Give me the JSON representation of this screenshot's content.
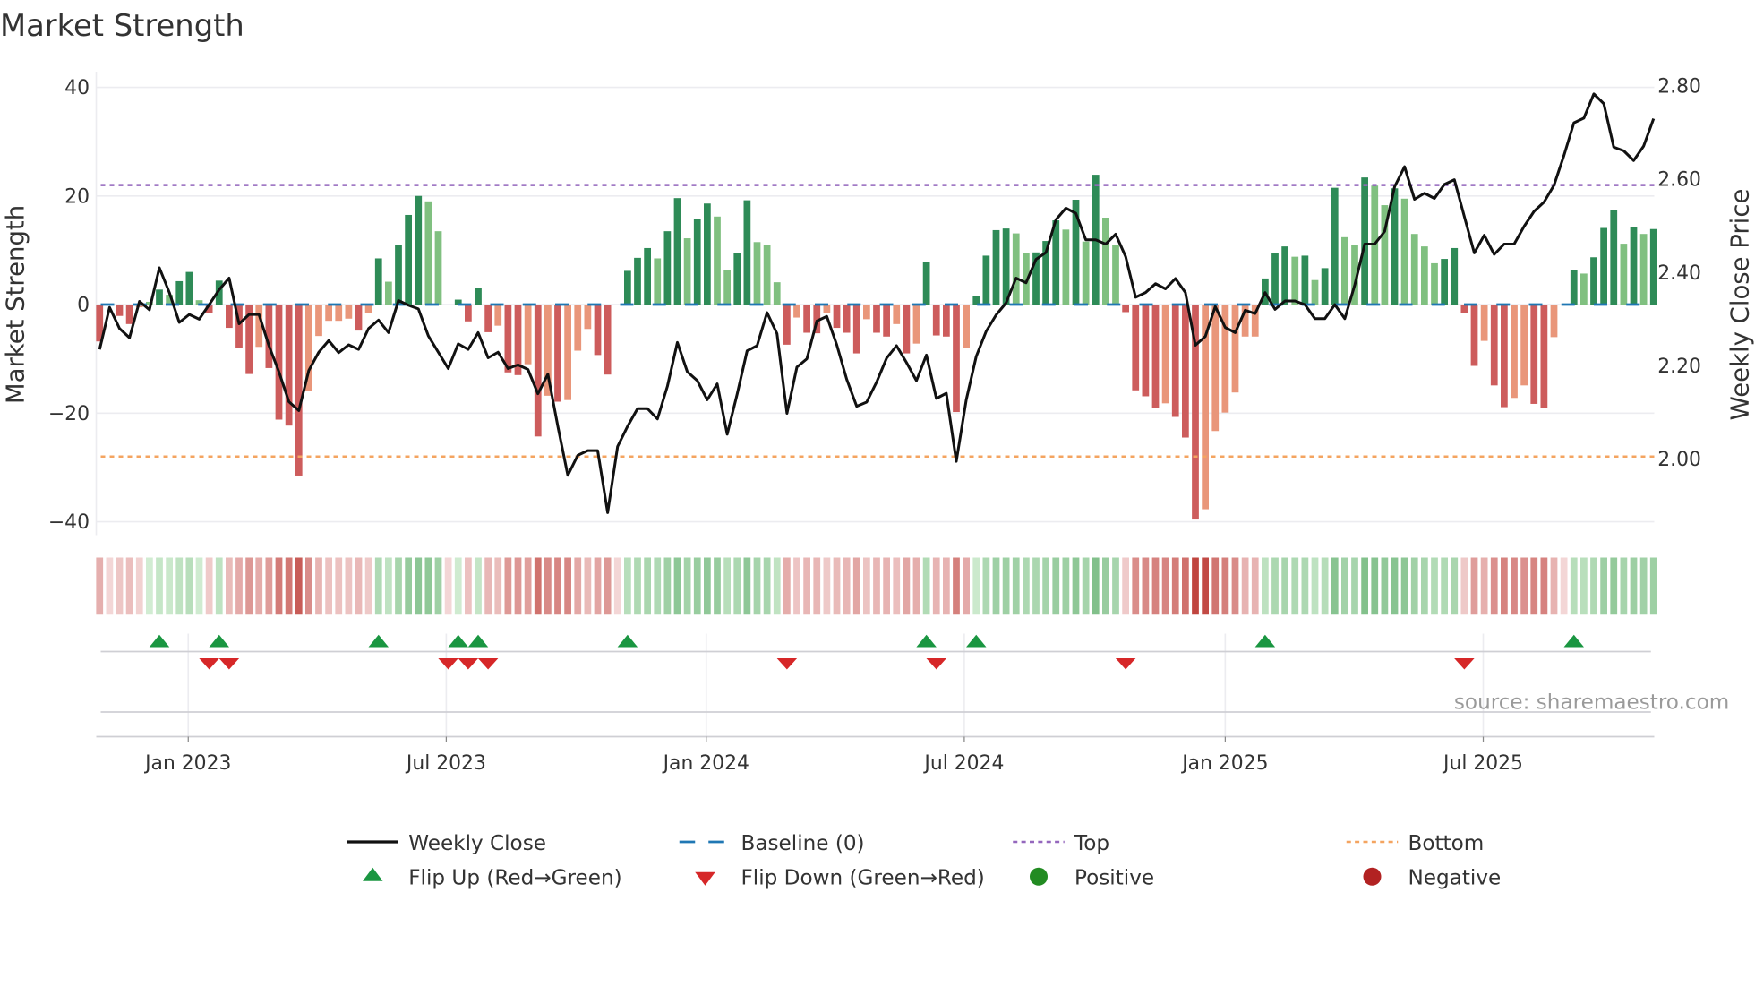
{
  "chart_data": {
    "type": "bar",
    "title": "Market Strength",
    "source": "source: sharemaestro.com",
    "ylabel": "Market Strength",
    "y2label": "Weekly Close Price",
    "ylim": [
      -42,
      42
    ],
    "y2lim": [
      1.87,
      2.81
    ],
    "top_level": 22,
    "bottom_level": -28,
    "grid": true,
    "y_left": {
      "ticks": [
        {
          "value": 40,
          "label": "40"
        },
        {
          "value": 20,
          "label": "20"
        },
        {
          "value": 0,
          "label": "0"
        },
        {
          "value": -20,
          "label": "−20"
        },
        {
          "value": -40,
          "label": "−40"
        }
      ]
    },
    "y_right": {
      "ticks": [
        {
          "value": 2.8,
          "label": "2.80"
        },
        {
          "value": 2.6,
          "label": "2.60"
        },
        {
          "value": 2.4,
          "label": "2.40"
        },
        {
          "value": 2.2,
          "label": "2.20"
        },
        {
          "value": 2.0,
          "label": "2.00"
        }
      ]
    },
    "x_ticks": [
      {
        "week": 8.9,
        "label": "Jan 2023"
      },
      {
        "week": 34.8,
        "label": "Jul 2023"
      },
      {
        "week": 60.9,
        "label": "Jan 2024"
      },
      {
        "week": 86.8,
        "label": "Jul 2024"
      },
      {
        "week": 113,
        "label": "Jan 2025"
      },
      {
        "week": 138.9,
        "label": "Jul 2025"
      }
    ],
    "strength": [
      -6.8,
      0,
      -2.1,
      -3.6,
      -0.5,
      0.5,
      2.75,
      1.8,
      4.3,
      6.0,
      0.8,
      -1.5,
      4.4,
      -4.3,
      -8,
      -12.8,
      -7.8,
      -11.7,
      -21.2,
      -22.3,
      -31.5,
      -16,
      -5.8,
      -3,
      -3,
      -2.6,
      -4.8,
      -1.6,
      8.5,
      4.2,
      11,
      16.5,
      20,
      19,
      13.5,
      0,
      0.9,
      -3.1,
      3.1,
      -5.1,
      -3.9,
      -12.5,
      -13,
      -11,
      -24.3,
      -16.8,
      -17.9,
      -17.6,
      -8.5,
      -4.5,
      -9.3,
      -12.9,
      0,
      6.2,
      8.6,
      10.4,
      8.5,
      13.5,
      19.6,
      12.2,
      15.8,
      18.6,
      16.2,
      6.3,
      9.5,
      19.2,
      11.5,
      10.9,
      4.1,
      -7.4,
      -2.4,
      -5.2,
      -5.3,
      -1.6,
      -4.3,
      -5.2,
      -9,
      -2.7,
      -5.2,
      -5.9,
      -3.6,
      -9,
      -7.2,
      7.9,
      -5.7,
      -5.9,
      -19.8,
      -8,
      1.6,
      9,
      13.7,
      14,
      13.1,
      9.5,
      9.6,
      11.7,
      15.5,
      13.8,
      19.3,
      11.6,
      23.9,
      16,
      10.9,
      -1.4,
      -15.8,
      -16.9,
      -19,
      -18.2,
      -20.7,
      -24.5,
      -39.6,
      -37.7,
      -23.3,
      -19.9,
      -16.2,
      -5.9,
      -5.9,
      4.8,
      9.4,
      10.7,
      8.8,
      9,
      4.5,
      6.7,
      21.5,
      12.4,
      10.9,
      23.4,
      21.9,
      18.3,
      21.4,
      19.5,
      13,
      10.7,
      7.6,
      8.4,
      10.4,
      -1.6,
      -11.3,
      -6.7,
      -14.9,
      -18.9,
      -17.2,
      -14.9,
      -18.3,
      -19,
      -6,
      0,
      6.3,
      5.7,
      8.7,
      14.1,
      17.4,
      11.2,
      14.3,
      13,
      13.9
    ],
    "shade": "R-RRrgGgGGgRGRRRrRRRRrrrrrRrGgGGGgg-GRGRrRRrRrRrrrRR-GGGgGGgGGggGGgggRrRRrRRRrRRrRrGRRRrGGGGggGGGgGgGggRRRRrRRRrrrrrrGGGgGgGGggGggGggggGGRRrRRrrRRr-GgGGGgGgG",
    "weekly_close": [
      2.235,
      2.325,
      2.28,
      2.26,
      2.338,
      2.32,
      2.41,
      2.357,
      2.293,
      2.31,
      2.3,
      2.331,
      2.363,
      2.388,
      2.29,
      2.31,
      2.31,
      2.243,
      2.187,
      2.123,
      2.104,
      2.19,
      2.229,
      2.254,
      2.228,
      2.245,
      2.235,
      2.28,
      2.298,
      2.271,
      2.34,
      2.33,
      2.322,
      2.264,
      2.229,
      2.194,
      2.247,
      2.235,
      2.271,
      2.217,
      2.229,
      2.194,
      2.202,
      2.192,
      2.14,
      2.182,
      2.07,
      1.965,
      2.008,
      2.018,
      2.018,
      1.885,
      2.027,
      2.07,
      2.108,
      2.108,
      2.086,
      2.156,
      2.25,
      2.187,
      2.168,
      2.127,
      2.161,
      2.053,
      2.139,
      2.232,
      2.243,
      2.314,
      2.269,
      2.098,
      2.197,
      2.215,
      2.296,
      2.306,
      2.245,
      2.171,
      2.113,
      2.122,
      2.165,
      2.216,
      2.243,
      2.207,
      2.168,
      2.223,
      2.13,
      2.141,
      1.995,
      2.127,
      2.22,
      2.274,
      2.309,
      2.335,
      2.388,
      2.378,
      2.428,
      2.443,
      2.513,
      2.538,
      2.527,
      2.47,
      2.47,
      2.461,
      2.482,
      2.434,
      2.347,
      2.357,
      2.376,
      2.365,
      2.387,
      2.357,
      2.244,
      2.263,
      2.327,
      2.282,
      2.271,
      2.319,
      2.312,
      2.357,
      2.321,
      2.339,
      2.339,
      2.331,
      2.301,
      2.301,
      2.331,
      2.301,
      2.373,
      2.461,
      2.461,
      2.488,
      2.584,
      2.627,
      2.557,
      2.57,
      2.559,
      2.589,
      2.599,
      2.52,
      2.442,
      2.48,
      2.439,
      2.461,
      2.461,
      2.499,
      2.531,
      2.551,
      2.587,
      2.651,
      2.721,
      2.731,
      2.783,
      2.762,
      2.669,
      2.661,
      2.64,
      2.671,
      2.73
    ],
    "flip_up_weeks": [
      6,
      12,
      28,
      36,
      38,
      53,
      83,
      88,
      117,
      148
    ],
    "flip_down_weeks": [
      11,
      13,
      35,
      37,
      39,
      69,
      84,
      103,
      137
    ],
    "colors": {
      "bar_dark_green": "#2e8b57",
      "bar_light_green": "#80c080",
      "bar_dark_red": "#cd5c5c",
      "bar_light_red": "#e9967a",
      "baseline": "#1f77b4",
      "top": "#9467bd",
      "bottom": "#f4a460",
      "flip_up": "#1a9641",
      "flip_down": "#d62728",
      "positive": "#228b22",
      "negative": "#b22222",
      "close": "#111111"
    },
    "legend": {
      "placement": "bottom",
      "items": [
        {
          "label": "Weekly Close",
          "kind": "line"
        },
        {
          "label": "Baseline (0)",
          "kind": "dash"
        },
        {
          "label": "Top",
          "kind": "dot-purple"
        },
        {
          "label": "Bottom",
          "kind": "dot-orange"
        },
        {
          "label": "Flip Up (Red→Green)",
          "kind": "tri-up"
        },
        {
          "label": "Flip Down (Green→Red)",
          "kind": "tri-down"
        },
        {
          "label": "Positive",
          "kind": "circle-green"
        },
        {
          "label": "Negative",
          "kind": "circle-red"
        }
      ]
    }
  }
}
